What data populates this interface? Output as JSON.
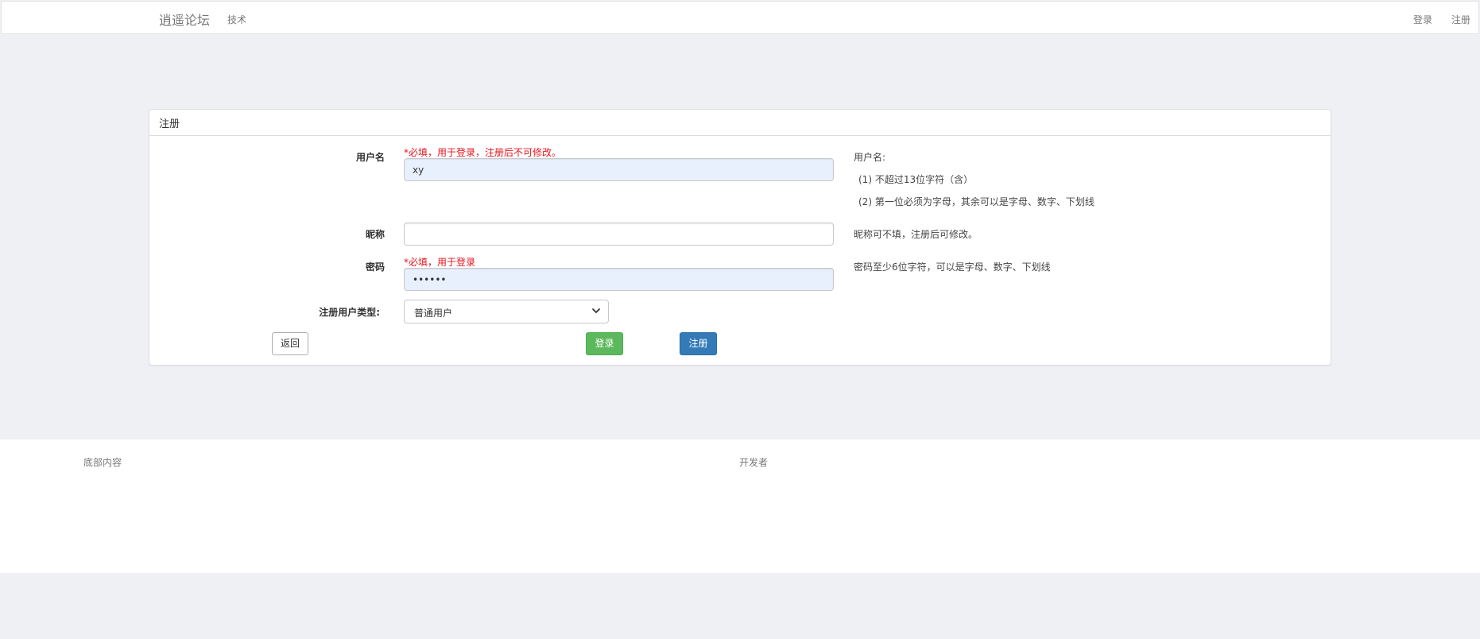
{
  "navbar": {
    "brand": "逍遥论坛",
    "nav_tech": "技术",
    "login": "登录",
    "register": "注册"
  },
  "panel": {
    "title": "注册"
  },
  "form": {
    "username": {
      "label": "用户名",
      "hint": "*必填，用于登录，注册后不可修改。",
      "value": "xy",
      "help_title": "用户名:",
      "help_rule1": "(1) 不超过13位字符（含）",
      "help_rule2": "(2) 第一位必须为字母，其余可以是字母、数字、下划线"
    },
    "nickname": {
      "label": "昵称",
      "value": "",
      "help": "昵称可不填，注册后可修改。"
    },
    "password": {
      "label": "密码",
      "hint": "*必填，用于登录",
      "value": "••••••",
      "help": "密码至少6位字符，可以是字母、数字、下划线"
    },
    "user_type": {
      "label": "注册用户类型:",
      "selected": "普通用户"
    }
  },
  "buttons": {
    "back": "返回",
    "login": "登录",
    "register": "注册"
  },
  "footer": {
    "left": "底部内容",
    "right": "开发者"
  },
  "colors": {
    "required_hint": "#e4151c",
    "login_button": "#5cb85c",
    "register_button": "#337ab7",
    "autofill_bg": "#e8f0fe"
  }
}
